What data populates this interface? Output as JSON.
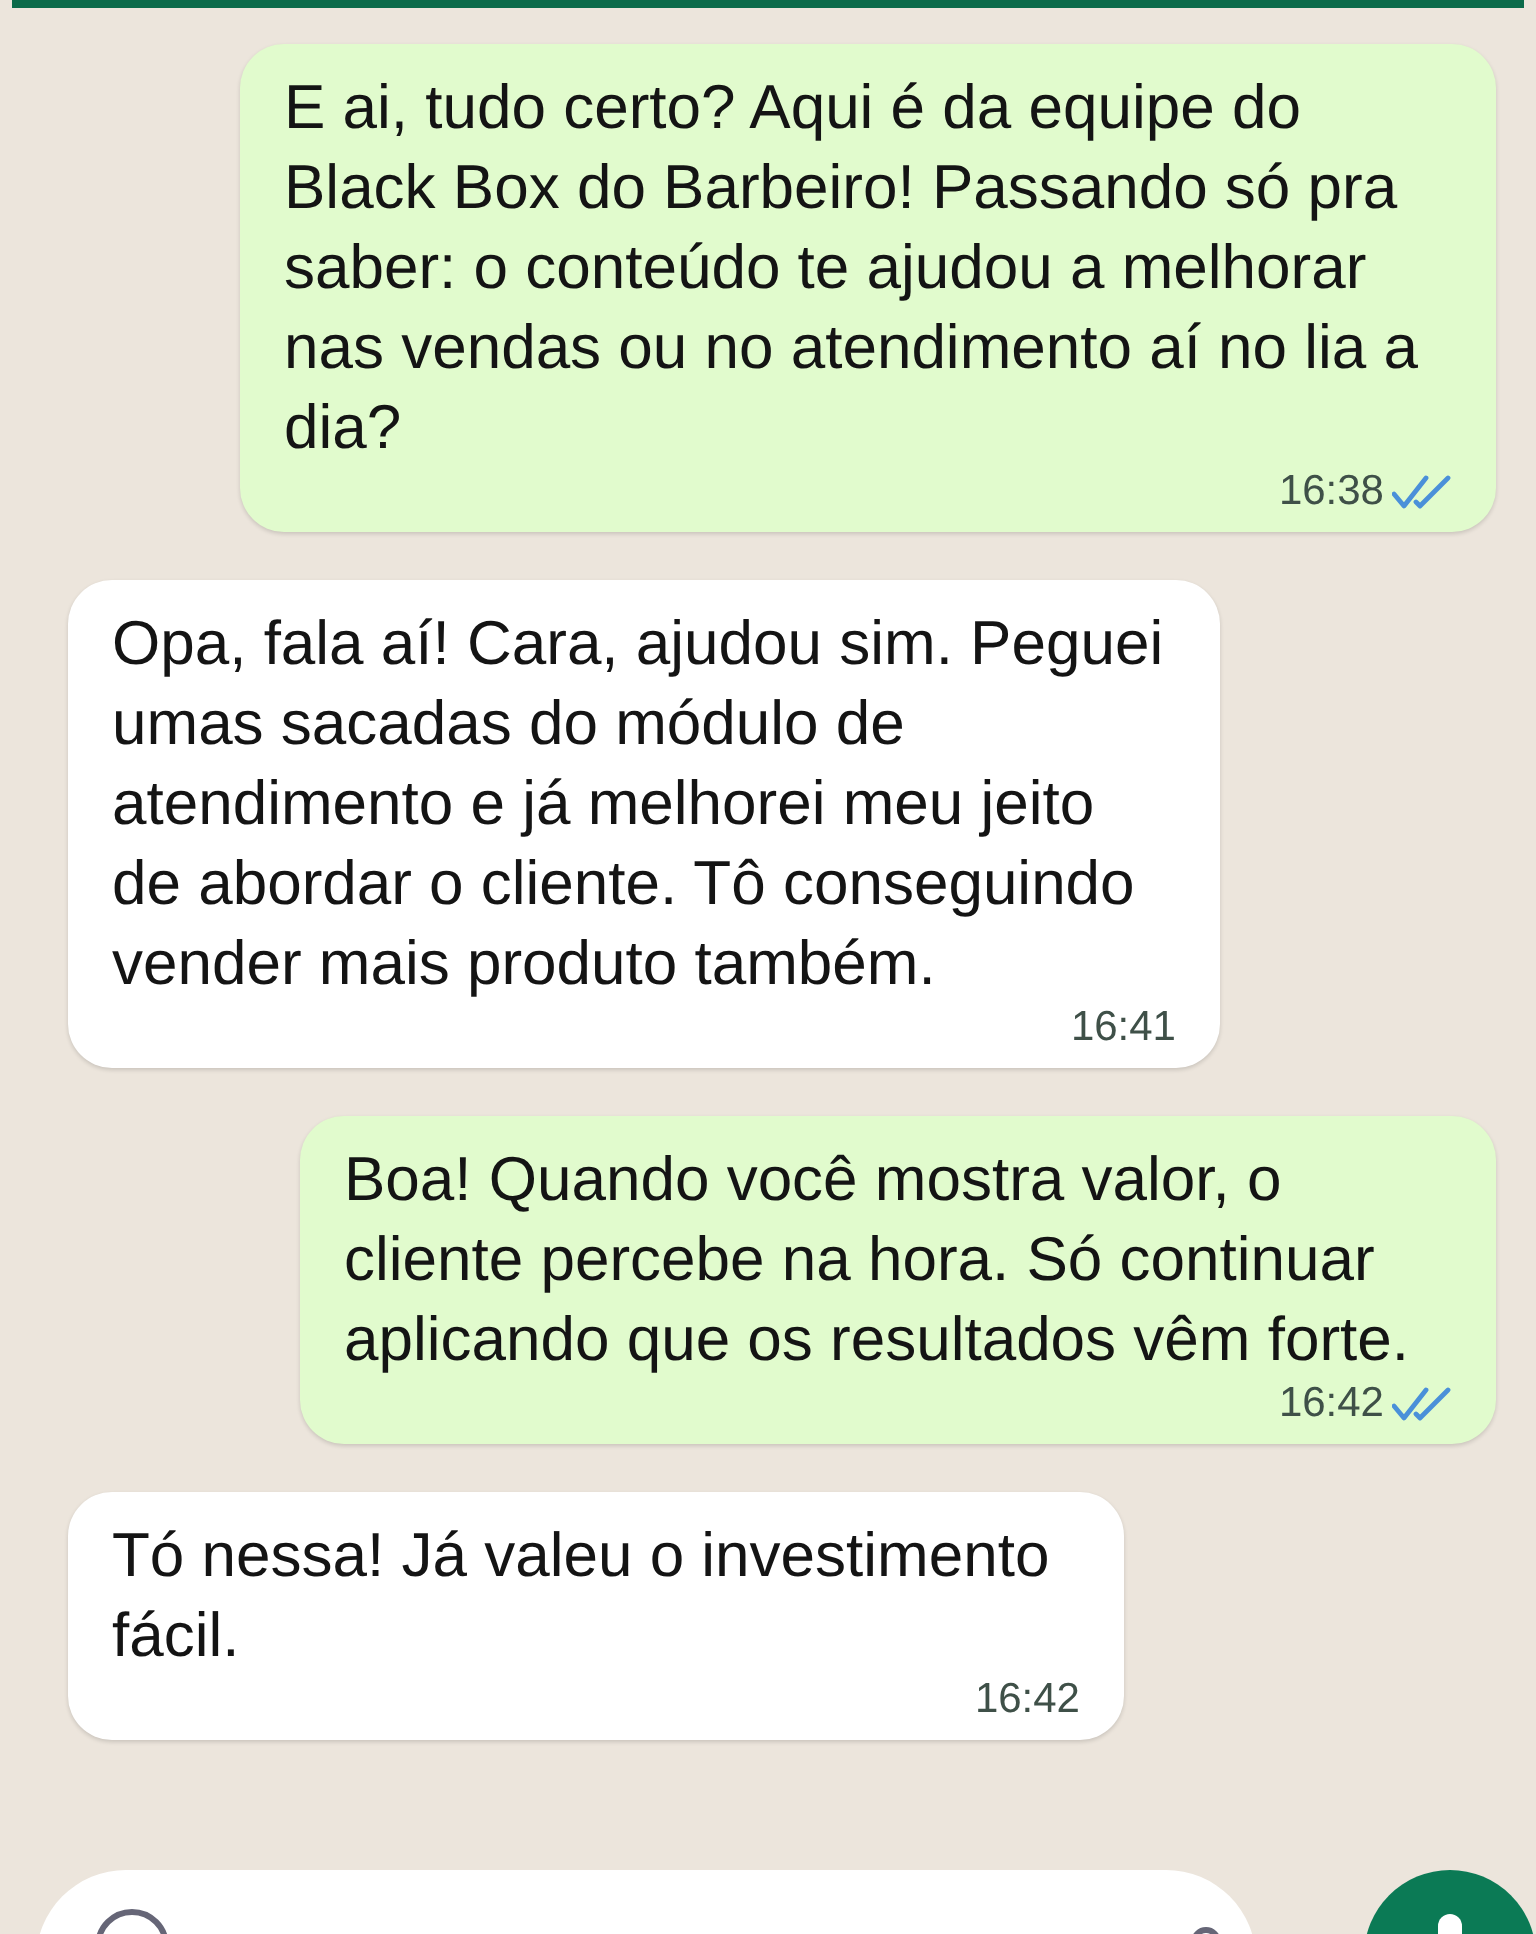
{
  "messages": [
    {
      "kind": "sent",
      "text": "E ai, tudo certo? Aqui é da equipe do Black Box do Barbeiro! Passando só pra saber: o conteúdo te ajudou a melhorar nas vendas ou no atendimento aí no lia a dia?",
      "time": "16:38",
      "read": true
    },
    {
      "kind": "received",
      "text": "Opa, fala aí! Cara, ajudou sim. Peguei umas sacadas do módulo de atendimento e já melhorei meu jeito de abordar o cliente. Tô conseguindo vender mais produto também.",
      "time": "16:41"
    },
    {
      "kind": "sent",
      "text": "Boa! Quando você mostra valor, o cliente percebe na hora. Só continuar aplicando que os resultados vêm forte.",
      "time": "16:42",
      "read": true
    },
    {
      "kind": "received",
      "text": "Tó nessa! Já valeu o investimento fácil.",
      "time": "16:42"
    }
  ]
}
